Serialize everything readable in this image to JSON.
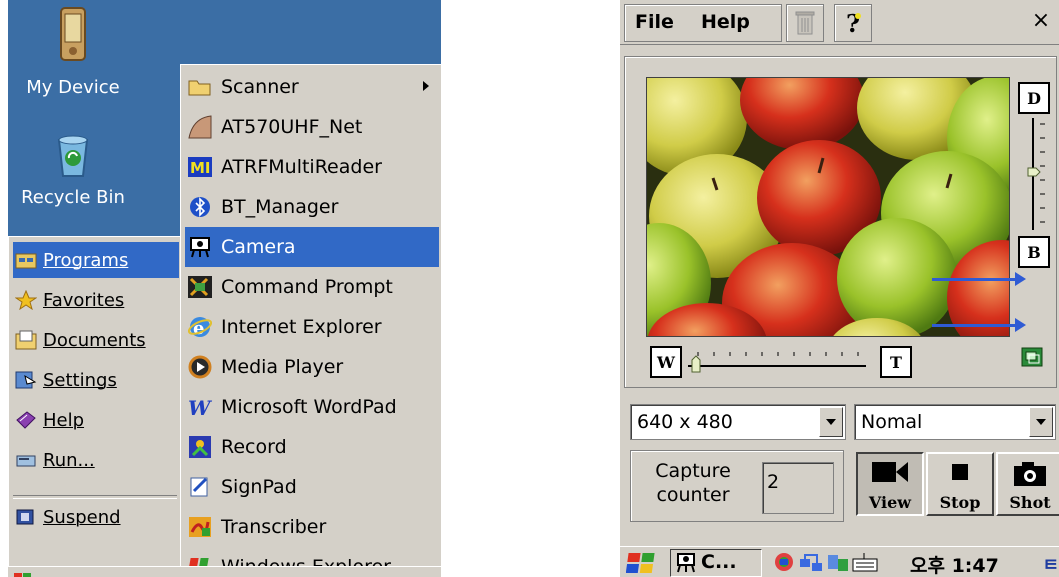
{
  "desktop": {
    "icons": [
      {
        "label": "My Device",
        "icon": "pda-device-icon"
      },
      {
        "label": "Recycle Bin",
        "icon": "recycle-bin-icon"
      }
    ]
  },
  "start_menu": {
    "items": [
      {
        "label": "Programs",
        "icon": "programs-folder-icon",
        "selected": true
      },
      {
        "label": "Favorites",
        "icon": "star-icon"
      },
      {
        "label": "Documents",
        "icon": "documents-icon"
      },
      {
        "label": "Settings",
        "icon": "settings-icon"
      },
      {
        "label": "Help",
        "icon": "help-book-icon"
      },
      {
        "label": "Run...",
        "icon": "run-icon"
      },
      {
        "label": "Suspend",
        "icon": "suspend-icon"
      }
    ]
  },
  "programs_menu": {
    "items": [
      {
        "label": "Scanner",
        "icon": "folder-icon",
        "submenu": true
      },
      {
        "label": "AT570UHF_Net",
        "icon": "uhf-app-icon"
      },
      {
        "label": "ATRFMultiReader",
        "icon": "multireader-icon"
      },
      {
        "label": "BT_Manager",
        "icon": "bluetooth-icon"
      },
      {
        "label": "Camera",
        "icon": "camera-icon",
        "selected": true
      },
      {
        "label": "Command Prompt",
        "icon": "command-prompt-icon"
      },
      {
        "label": "Internet Explorer",
        "icon": "internet-explorer-icon"
      },
      {
        "label": "Media Player",
        "icon": "media-player-icon"
      },
      {
        "label": "Microsoft WordPad",
        "icon": "wordpad-icon"
      },
      {
        "label": "Record",
        "icon": "record-icon"
      },
      {
        "label": "SignPad",
        "icon": "signpad-icon"
      },
      {
        "label": "Transcriber",
        "icon": "transcriber-icon"
      },
      {
        "label": "Windows Explorer",
        "icon": "windows-explorer-icon"
      }
    ]
  },
  "camera_app": {
    "menu": {
      "file_label": "File",
      "help_label": "Help",
      "close_label": "×"
    },
    "side_buttons": {
      "dark": "D",
      "bright": "B",
      "wide": "W",
      "tele": "T"
    },
    "resolution": "640 x 480",
    "mode": "Nomal",
    "counter_label": "Capture counter",
    "counter_value": "2",
    "buttons": {
      "view": "View",
      "stop": "Stop",
      "shot": "Shot"
    }
  },
  "taskbar": {
    "app_label": "C...",
    "clock": "오후 1:47",
    "ime_label": "ㅌ"
  },
  "colors": {
    "desktop": "#3b6ea5",
    "selection": "#3169c6",
    "menu_face": "#d4d0c8",
    "arrow": "#2f5bd4"
  }
}
